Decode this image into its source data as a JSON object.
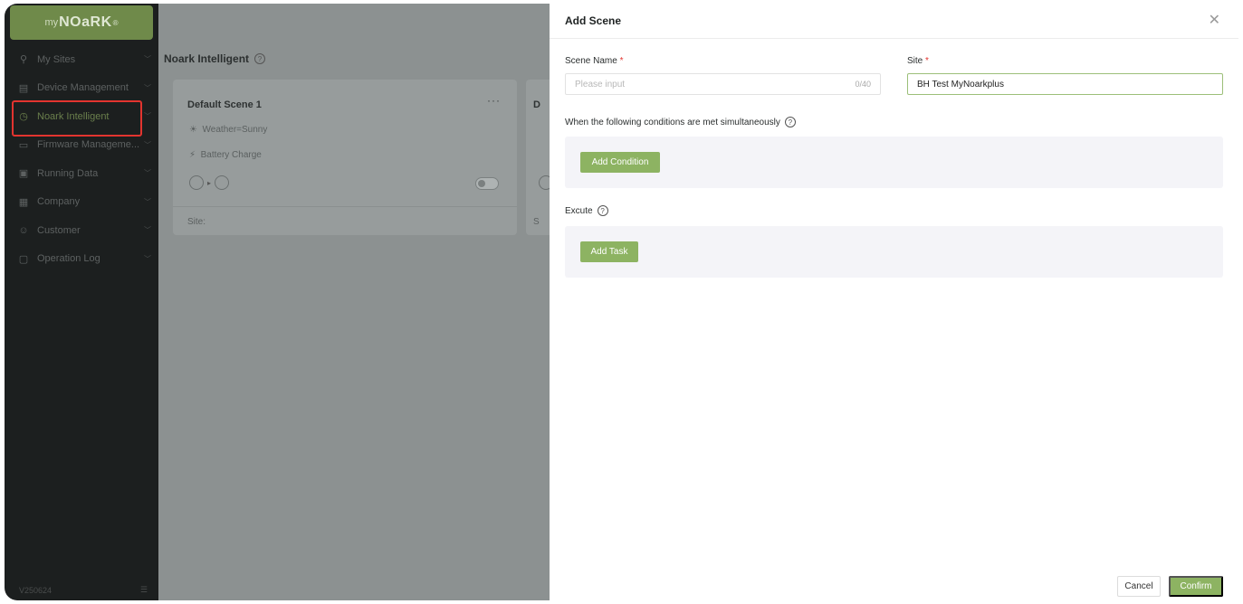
{
  "sidebar": {
    "logo": {
      "prefix": "my",
      "brand": "NOaRK",
      "mark": "®"
    },
    "items": [
      {
        "label": "My Sites",
        "icon": "site-icon",
        "glyph": "⚲"
      },
      {
        "label": "Device Management",
        "icon": "device-icon",
        "glyph": "▤"
      },
      {
        "label": "Noark Intelligent",
        "icon": "intelligent-icon",
        "glyph": "◷"
      },
      {
        "label": "Firmware Manageme...",
        "icon": "firmware-icon",
        "glyph": "▭"
      },
      {
        "label": "Running Data",
        "icon": "data-icon",
        "glyph": "▣"
      },
      {
        "label": "Company",
        "icon": "company-icon",
        "glyph": "▦"
      },
      {
        "label": "Customer",
        "icon": "customer-icon",
        "glyph": "☺"
      },
      {
        "label": "Operation Log",
        "icon": "log-icon",
        "glyph": "▢"
      }
    ],
    "active_index": 2,
    "version": "V250624",
    "collapse_label": "☰"
  },
  "main": {
    "title": "Noark Intelligent",
    "card": {
      "title": "Default Scene 1",
      "conditions": [
        "Weather=Sunny",
        "Battery Charge"
      ],
      "site_label": "Site:"
    },
    "card2": {
      "title": "D",
      "site_label": "S"
    }
  },
  "drawer": {
    "title": "Add Scene",
    "scene_name_label": "Scene Name",
    "scene_name_placeholder": "Please input",
    "scene_name_counter": "0/40",
    "site_label": "Site",
    "site_value": "BH Test MyNoarkplus",
    "conditions_label": "When the following conditions are met simultaneously",
    "add_condition_label": "Add Condition",
    "execute_label": "Excute",
    "add_task_label": "Add Task",
    "cancel_label": "Cancel",
    "confirm_label": "Confirm"
  },
  "colors": {
    "accent": "#8db362",
    "sidebar_bg": "#1c1f1f",
    "highlight": "#e3342f"
  }
}
